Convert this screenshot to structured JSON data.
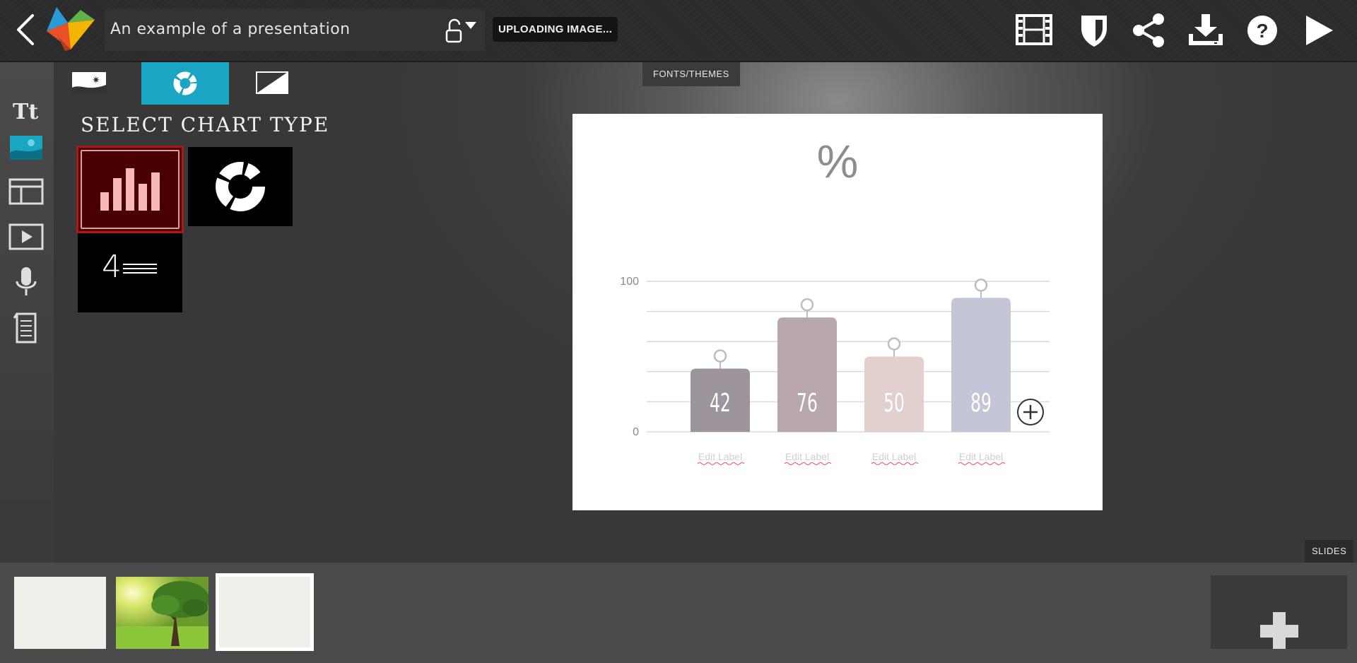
{
  "header": {
    "presentation_title": "An example of a presentation",
    "upload_status": "UPLOADING IMAGE...",
    "icons": [
      "back-icon",
      "logo-icon",
      "lock-icon",
      "filmstrip-icon",
      "shield-icon",
      "share-icon",
      "download-icon",
      "help-icon",
      "play-icon"
    ]
  },
  "fonts_tab": "FONTS/THEMES",
  "left_tools": [
    "text-tool-icon",
    "image-tool-icon",
    "layout-tool-icon",
    "video-tool-icon",
    "microphone-icon",
    "notes-icon"
  ],
  "panel": {
    "title": "SELECT CHART TYPE",
    "tabs": [
      "image-tab-icon",
      "chart-tab-icon",
      "background-tab-icon"
    ],
    "options": [
      "bar-chart-option",
      "donut-chart-option",
      "number-chart-option"
    ],
    "number_option_glyph": "4"
  },
  "chart_data": {
    "type": "bar",
    "title": "%",
    "categories": [
      "Edit Label",
      "Edit Label",
      "Edit Label",
      "Edit Label"
    ],
    "values": [
      42,
      76,
      50,
      89
    ],
    "ylim": [
      0,
      100
    ],
    "y_ticks": [
      "0",
      "100"
    ],
    "colors": [
      "#9e949e",
      "#b9a8ab",
      "#e1d0cd",
      "#c4c6d7"
    ],
    "grid": true
  },
  "slides_tab": "SLIDES",
  "slides": [
    {
      "name": "slide-thumb-1",
      "kind": "blank"
    },
    {
      "name": "slide-thumb-2",
      "kind": "tree-photo"
    },
    {
      "name": "slide-thumb-3",
      "kind": "blank",
      "selected": true
    }
  ],
  "colors": {
    "accent": "#1aa5c2",
    "selected_option_bg": "#4a0000",
    "selected_option_border": "#b01616"
  }
}
